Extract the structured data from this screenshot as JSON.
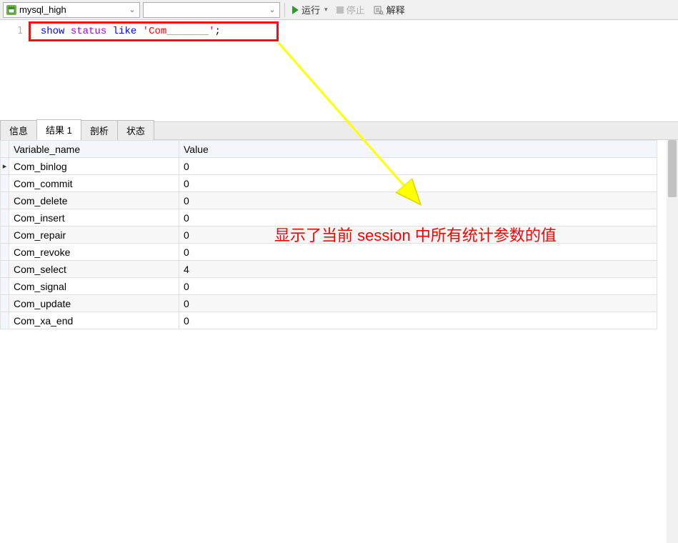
{
  "toolbar": {
    "db_name": "mysql_high",
    "run_label": "运行",
    "stop_label": "停止",
    "explain_label": "解释"
  },
  "editor": {
    "line_number": "1",
    "kw_show": "show",
    "kw_status": "status",
    "kw_like": "like",
    "str_quote1": "'",
    "str_com": "Com",
    "str_blanks": "_______",
    "str_quote2": "'",
    "semi": ";"
  },
  "tabs": {
    "info": "信息",
    "result": "结果 1",
    "profile": "剖析",
    "state": "状态"
  },
  "grid": {
    "headers": {
      "var": "Variable_name",
      "val": "Value"
    },
    "rows": [
      {
        "name": "Com_binlog",
        "value": "0"
      },
      {
        "name": "Com_commit",
        "value": "0"
      },
      {
        "name": "Com_delete",
        "value": "0"
      },
      {
        "name": "Com_insert",
        "value": "0"
      },
      {
        "name": "Com_repair",
        "value": "0"
      },
      {
        "name": "Com_revoke",
        "value": "0"
      },
      {
        "name": "Com_select",
        "value": "4"
      },
      {
        "name": "Com_signal",
        "value": "0"
      },
      {
        "name": "Com_update",
        "value": "0"
      },
      {
        "name": "Com_xa_end",
        "value": "0"
      }
    ]
  },
  "annotation": "显示了当前 session 中所有统计参数的值"
}
